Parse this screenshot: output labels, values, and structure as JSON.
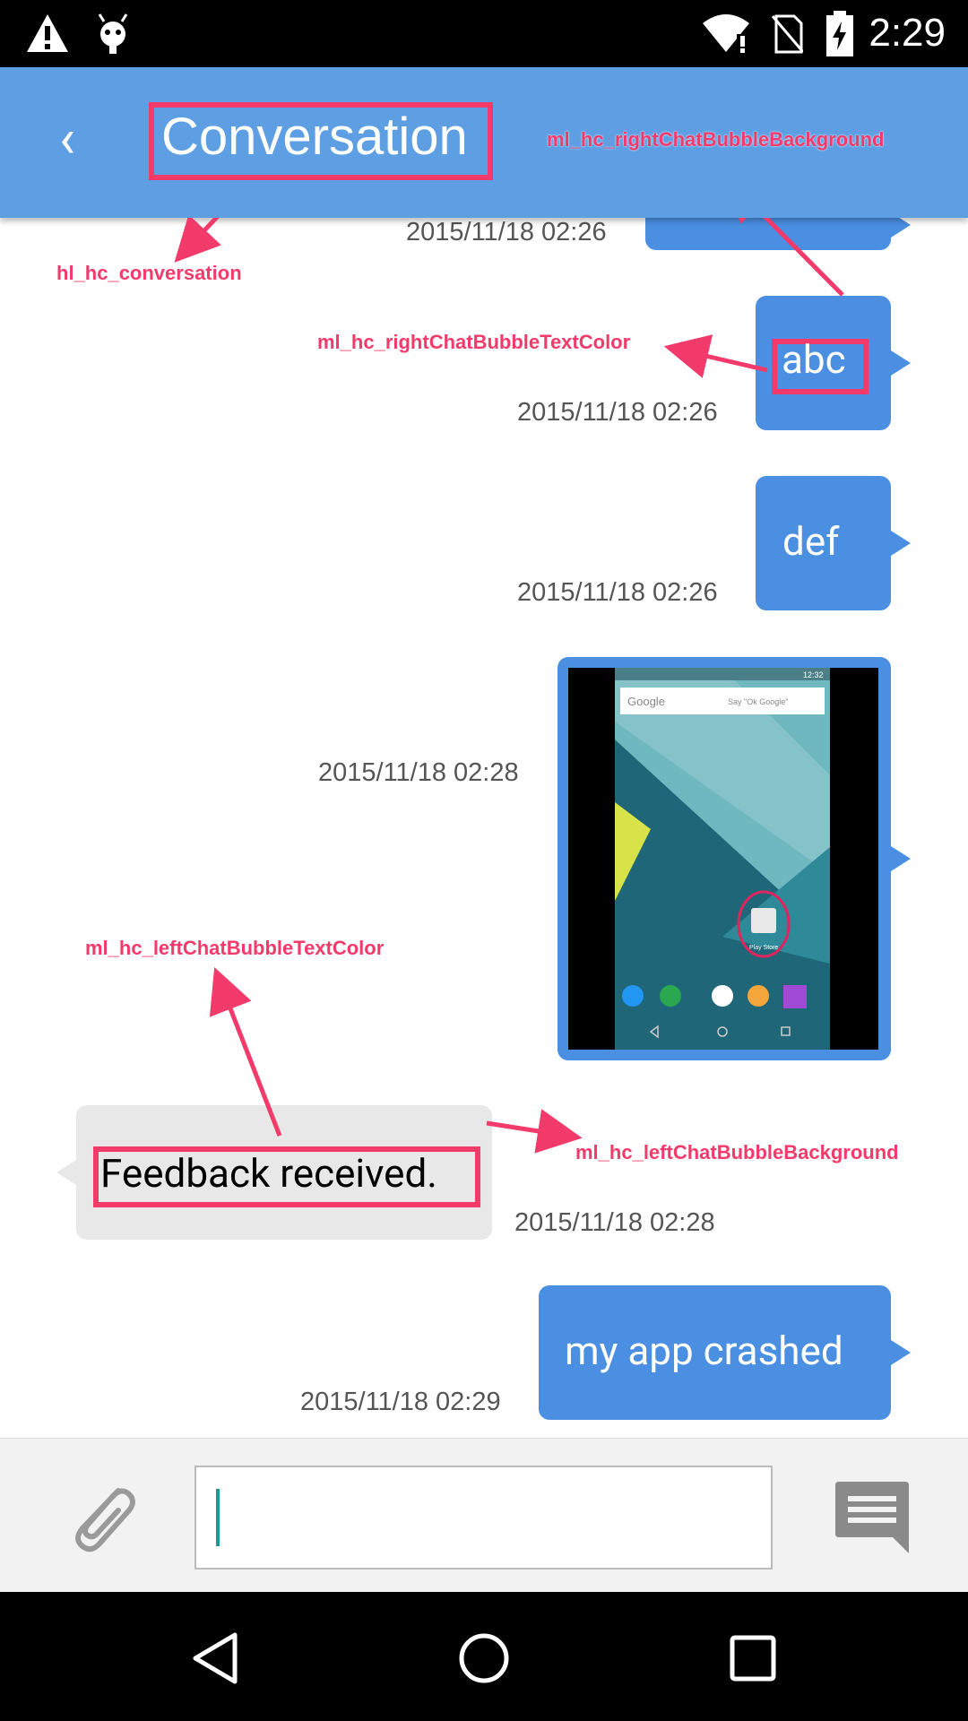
{
  "status_bar": {
    "time": "2:29"
  },
  "app_bar": {
    "title": "Conversation"
  },
  "annotations": {
    "title_key": "hl_hc_conversation",
    "right_bg_key": "ml_hc_rightChatBubbleBackground",
    "right_text_key": "ml_hc_rightChatBubbleTextColor",
    "left_text_key": "ml_hc_leftChatBubbleTextColor",
    "left_bg_key": "ml_hc_leftChatBubbleBackground"
  },
  "messages": [
    {
      "side": "right",
      "text": "",
      "time": "2015/11/18 02:26"
    },
    {
      "side": "right",
      "text": "abc",
      "time": "2015/11/18 02:26"
    },
    {
      "side": "right",
      "text": "def",
      "time": "2015/11/18 02:26"
    },
    {
      "side": "right",
      "type": "image",
      "time": "2015/11/18 02:28",
      "image": {
        "search_text": "Google",
        "voice_hint": "Say \"Ok Google\"",
        "clock": "12:32",
        "app_label": "Play Store"
      }
    },
    {
      "side": "left",
      "text": "Feedback received.",
      "time": "2015/11/18 02:28"
    },
    {
      "side": "right",
      "text": "my app crashed",
      "time": "2015/11/18 02:29"
    }
  ],
  "colors": {
    "app_bar": "#5e9fe4",
    "right_bubble": "#4b8fe2",
    "left_bubble": "#e8e8e8",
    "annotation": "#f23a6b"
  },
  "icons": [
    "warning-icon",
    "android-icon",
    "wifi-icon",
    "no-sim-icon",
    "battery-charging-icon",
    "back-icon",
    "attach-icon",
    "send-icon",
    "nav-back-icon",
    "nav-home-icon",
    "nav-recents-icon"
  ]
}
